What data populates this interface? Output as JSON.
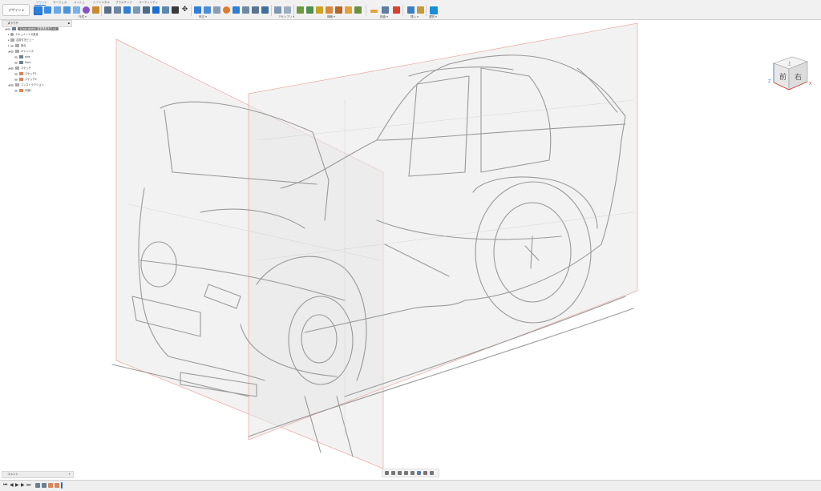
{
  "toolbar": {
    "workspace_label": "デザイン ▾",
    "tabs": [
      {
        "label": "ソリッド",
        "active": true
      },
      {
        "label": "サーフェス",
        "active": false
      },
      {
        "label": "メッシュ",
        "active": false
      },
      {
        "label": "シートメタル",
        "active": false
      },
      {
        "label": "プラスチック",
        "active": false
      },
      {
        "label": "ユーティリティ",
        "active": false
      }
    ],
    "groups": [
      "作成 ▾",
      "修正 ▾",
      "アセンブリ ▾",
      "構築 ▾",
      "検査 ▾",
      "挿入 ▾",
      "選択 ▾"
    ]
  },
  "browser": {
    "title": "ブラウザ",
    "items": [
      {
        "label": "Q-car-sketch 変更履歴あり v1",
        "icon": "document-icon"
      },
      {
        "label": "ドキュメントの設定",
        "icon": "gear-icon"
      },
      {
        "label": "名前付きビュー",
        "icon": "folder-icon"
      },
      {
        "label": "原点",
        "icon": "origin-icon"
      },
      {
        "label": "キャンバス",
        "icon": "folder-icon"
      },
      {
        "label": "side",
        "icon": "canvas-icon"
      },
      {
        "label": "front",
        "icon": "canvas-icon"
      },
      {
        "label": "スケッチ",
        "icon": "folder-icon"
      },
      {
        "label": "スケッチ1",
        "icon": "sketch-icon"
      },
      {
        "label": "スケッチ2",
        "icon": "sketch-icon"
      },
      {
        "label": "コンストラクション",
        "icon": "folder-icon"
      },
      {
        "label": "平面1",
        "icon": "plane-icon"
      }
    ]
  },
  "viewcube": {
    "face_front": "前",
    "face_right": "右",
    "face_top": "上",
    "axis_x": "X",
    "axis_z": "Z"
  },
  "comments": {
    "title": "コメント",
    "add": "+"
  },
  "colors": {
    "accent": "#1a6fd1",
    "canvas_border": "#e8a9a0",
    "toolbar_bg": "#f1f1f1"
  }
}
